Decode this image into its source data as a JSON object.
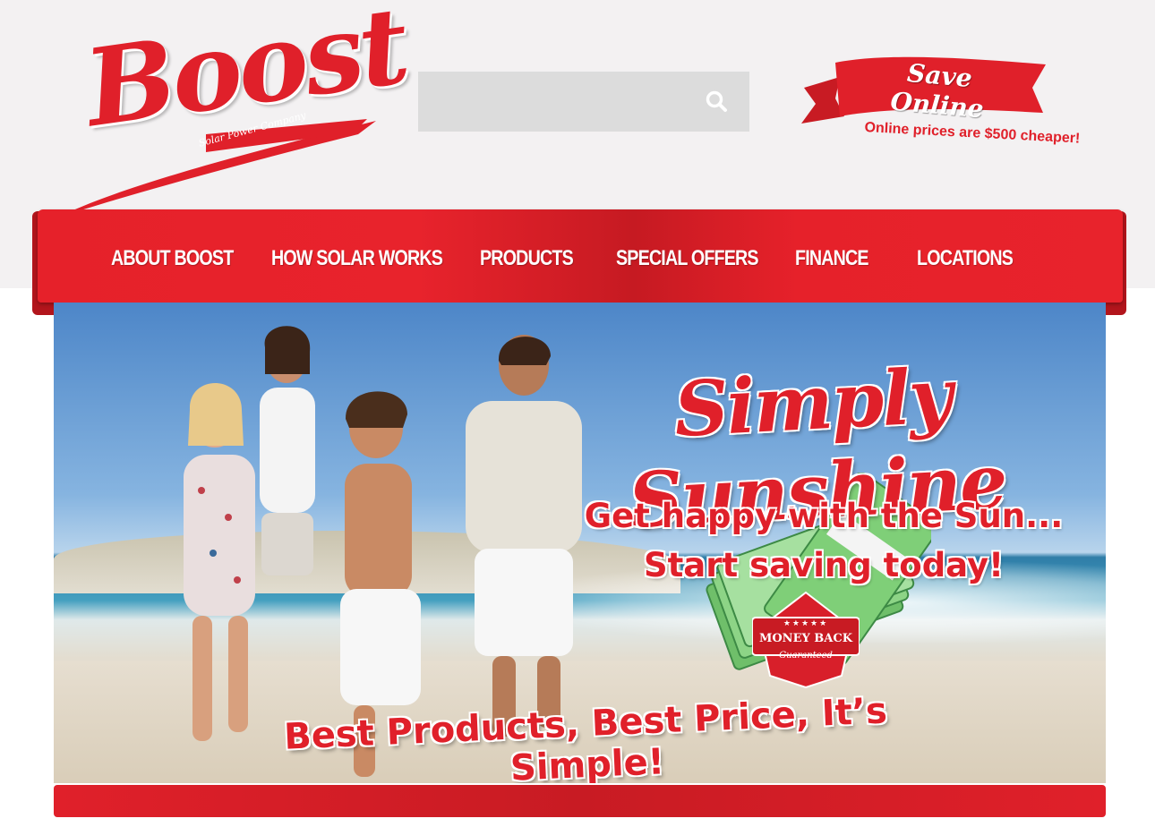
{
  "brand": {
    "name": "Boost",
    "tagline": "Solar Power Company",
    "color": "#e0202a"
  },
  "search": {
    "placeholder": "",
    "icon": "search-icon"
  },
  "promo": {
    "ribbon_label": "Save Online",
    "subtext": "Online prices are $500 cheaper!"
  },
  "nav": {
    "items": [
      {
        "label": "ABOUT BOOST"
      },
      {
        "label": "HOW SOLAR WORKS"
      },
      {
        "label": "PRODUCTS"
      },
      {
        "label": "SPECIAL OFFERS"
      },
      {
        "label": "FINANCE"
      },
      {
        "label": "LOCATIONS"
      }
    ]
  },
  "hero": {
    "headline": "Simply Sunshine",
    "line1": "Get happy with the Sun...",
    "line2": "Start saving today!",
    "badge": {
      "stars": "★★★★★",
      "label": "MONEY BACK",
      "sub": "Guaranteed"
    },
    "tagline": "Best Products, Best Price, It’s Simple!"
  }
}
